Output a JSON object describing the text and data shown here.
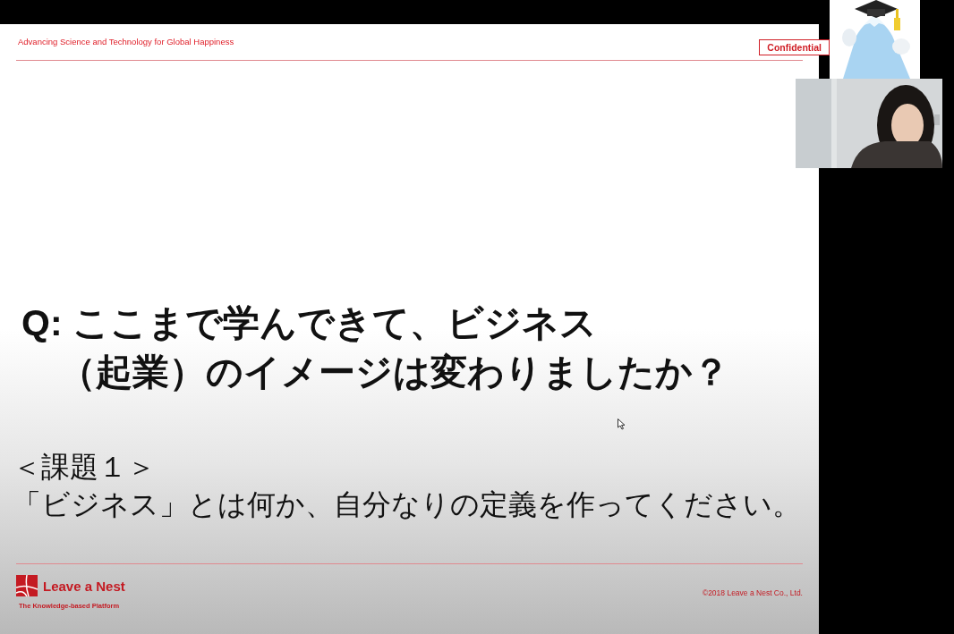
{
  "slide": {
    "header": "Advancing Science and Technology for Global Happiness",
    "confidential": "Confidential",
    "question_lines": [
      "Q: ここまで学んできて、ビジネス",
      "（起業）のイメージは変わりましたか？"
    ],
    "task_title": "＜課題１＞",
    "task_text": "「ビジネス」とは何か、自分なりの定義を作ってください。",
    "logo_name": "Leave a Nest",
    "tagline": "The Knowledge-based Platform",
    "copyright": "©2018 Leave a Nest Co., Ltd."
  }
}
